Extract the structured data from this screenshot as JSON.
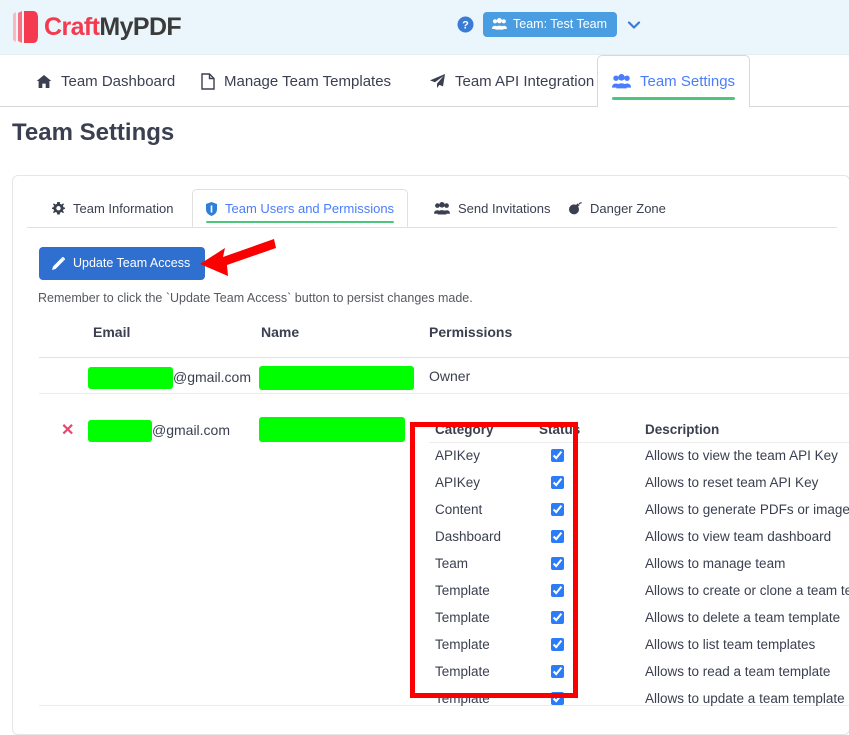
{
  "header": {
    "logo_craft": "Craft",
    "logo_mypdf": "MyPDF",
    "logo_icon": "stacked-pages-icon",
    "help_icon": "question-circle-icon",
    "team_badge_label": "Team: Test Team",
    "team_badge_icon": "users-group-icon",
    "team_caret_icon": "chevron-down-icon",
    "badge_color": "#4a9de0",
    "bar_background": "#eaf6fb"
  },
  "main_nav": {
    "tabs": [
      {
        "label": "Team Dashboard",
        "icon": "home-icon",
        "active": false
      },
      {
        "label": "Manage Team Templates",
        "icon": "file-icon",
        "active": false
      },
      {
        "label": "Team API Integration",
        "icon": "paper-plane-icon",
        "active": false
      },
      {
        "label": "Team Settings",
        "icon": "users-group-icon",
        "active": true
      }
    ],
    "active_underline_color": "#4bc77d",
    "active_text_color": "#4a7dfc"
  },
  "page": {
    "title": "Team Settings"
  },
  "inner_tabs": {
    "tabs": [
      {
        "label": "Team Information",
        "icon": "gear-icon",
        "active": false
      },
      {
        "label": "Team Users and Permissions",
        "icon": "shield-icon",
        "active": true
      },
      {
        "label": "Send Invitations",
        "icon": "users-group-icon",
        "active": false
      },
      {
        "label": "Danger Zone",
        "icon": "bomb-icon",
        "active": false
      }
    ]
  },
  "actions": {
    "update_button_label": "Update Team Access",
    "update_button_icon": "pencil-icon",
    "update_button_color": "#2f6fd0",
    "hint_text": "Remember to click the `Update Team Access` button to persist changes made."
  },
  "users_table": {
    "columns": [
      "Email",
      "Name",
      "Permissions"
    ],
    "rows": [
      {
        "email_redacted": true,
        "email_suffix": "@gmail.com",
        "name_redacted": true,
        "permissions_label": "Owner",
        "deletable": false
      },
      {
        "email_redacted": true,
        "email_suffix": "@gmail.com",
        "name_redacted": true,
        "permissions_label": "",
        "deletable": true,
        "delete_icon": "x-remove-icon"
      }
    ],
    "redaction_color": "#00ff00"
  },
  "permissions_table": {
    "columns": [
      "Category",
      "Status",
      "Description"
    ],
    "rows": [
      {
        "category": "APIKey",
        "checked": true,
        "description": "Allows to view the team API Key"
      },
      {
        "category": "APIKey",
        "checked": true,
        "description": "Allows to reset team API Key"
      },
      {
        "category": "Content",
        "checked": true,
        "description": "Allows to generate PDFs or images"
      },
      {
        "category": "Dashboard",
        "checked": true,
        "description": "Allows to view team dashboard"
      },
      {
        "category": "Team",
        "checked": true,
        "description": "Allows to manage team"
      },
      {
        "category": "Template",
        "checked": true,
        "description": "Allows to create or clone a team template"
      },
      {
        "category": "Template",
        "checked": true,
        "description": "Allows to delete a team template"
      },
      {
        "category": "Template",
        "checked": true,
        "description": "Allows to list team templates"
      },
      {
        "category": "Template",
        "checked": true,
        "description": "Allows to read a team template"
      },
      {
        "category": "Template",
        "checked": true,
        "description": "Allows to update a team template"
      }
    ],
    "checkbox_color": "#2b7cf7"
  },
  "annotations": {
    "arrow": {
      "shape": "left-pointing-arrow",
      "color": "#fb0000"
    },
    "box": {
      "shape": "rectangle-highlight",
      "color": "#fb0000"
    }
  }
}
